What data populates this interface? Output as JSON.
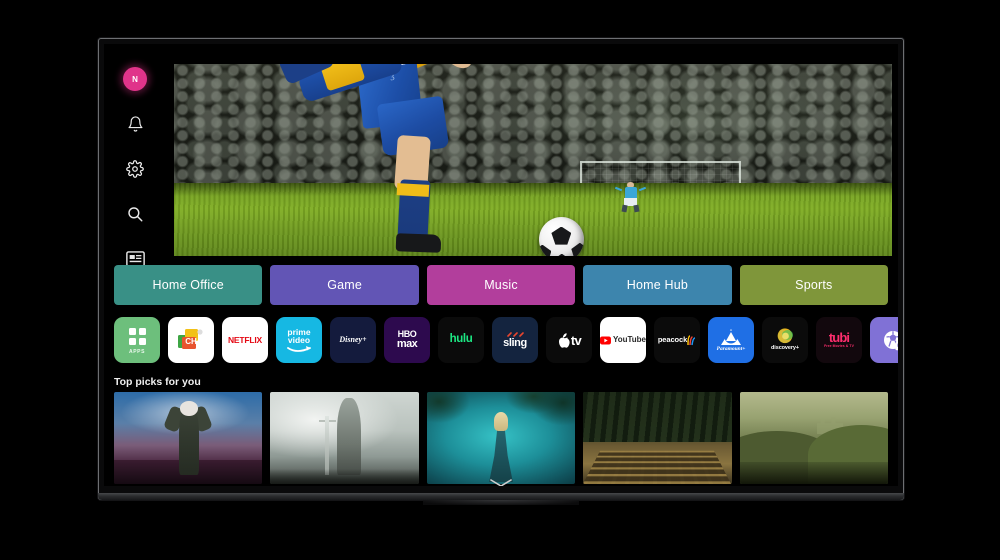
{
  "device": {
    "name": "smart-tv",
    "brand_ui": "webOS Home"
  },
  "sidebar": {
    "profile": {
      "initial": "N",
      "color": "#e0348a",
      "icon": "user-avatar"
    },
    "items": [
      {
        "id": "notifications",
        "icon": "bell-icon",
        "label": "Notifications"
      },
      {
        "id": "settings",
        "icon": "gear-icon",
        "label": "Settings"
      },
      {
        "id": "search",
        "icon": "search-icon",
        "label": "Search"
      },
      {
        "id": "inputs",
        "icon": "input-source-icon",
        "label": "Inputs"
      }
    ]
  },
  "hero": {
    "name": "sports-hero-banner",
    "description": "Soccer player kicking ball toward goal in the rain",
    "alt": "Sports"
  },
  "categories": [
    {
      "label": "Home Office",
      "color": "#399086"
    },
    {
      "label": "Game",
      "color": "#6255b5"
    },
    {
      "label": "Music",
      "color": "#b23e9c"
    },
    {
      "label": "Home Hub",
      "color": "#3d85ad"
    },
    {
      "label": "Sports",
      "color": "#7f963a"
    }
  ],
  "apps": [
    {
      "id": "apps",
      "label": "APPS",
      "sub": "",
      "bg": "#6dbf7c",
      "fg": "#ffffff",
      "icon": "grid-apps-icon"
    },
    {
      "id": "channels",
      "label": "CH",
      "sub": "",
      "bg": "#ffffff",
      "fg": "#e8542f",
      "icon": "channels-icon"
    },
    {
      "id": "netflix",
      "label": "NETFLIX",
      "sub": "",
      "bg": "#ffffff",
      "fg": "#e50914",
      "icon": "netflix-icon"
    },
    {
      "id": "prime-video",
      "label": "prime",
      "sub": "video",
      "bg": "#16b8e3",
      "fg": "#ffffff",
      "icon": "prime-video-icon"
    },
    {
      "id": "disney-plus",
      "label": "Disney+",
      "sub": "",
      "bg": "#141b3d",
      "fg": "#ffffff",
      "icon": "disney-plus-icon"
    },
    {
      "id": "hbo-max",
      "label": "HBO",
      "sub": "max",
      "bg": "#2d0a4e",
      "fg": "#ffffff",
      "icon": "hbo-max-icon"
    },
    {
      "id": "hulu",
      "label": "hulu",
      "sub": "",
      "bg": "#0b0b0b",
      "fg": "#1ce783",
      "icon": "hulu-icon"
    },
    {
      "id": "sling",
      "label": "sling",
      "sub": "",
      "bg": "#14243f",
      "fg": "#ffffff",
      "icon": "sling-icon"
    },
    {
      "id": "apple-tv",
      "label": "tv",
      "sub": "",
      "bg": "#0b0b0b",
      "fg": "#ffffff",
      "icon": "apple-tv-icon"
    },
    {
      "id": "youtube",
      "label": "YouTube",
      "sub": "",
      "bg": "#ffffff",
      "fg": "#282828",
      "icon": "youtube-icon"
    },
    {
      "id": "peacock",
      "label": "peacock",
      "sub": "",
      "bg": "#0b0b0b",
      "fg": "#ffffff",
      "icon": "peacock-icon"
    },
    {
      "id": "paramount",
      "label": "Paramount+",
      "sub": "",
      "bg": "#1f6fe5",
      "fg": "#ffffff",
      "icon": "paramount-plus-icon"
    },
    {
      "id": "discovery",
      "label": "discovery+",
      "sub": "",
      "bg": "#0b0b0b",
      "fg": "#ffffff",
      "icon": "discovery-plus-icon"
    },
    {
      "id": "tubi",
      "label": "tubi",
      "sub": "Free Movies & TV",
      "bg": "#12080d",
      "fg": "#ff2e6e",
      "icon": "tubi-icon"
    },
    {
      "id": "sports-app",
      "label": "",
      "sub": "",
      "bg": "#8071d6",
      "fg": "#ffffff",
      "icon": "soccer-ball-icon"
    }
  ],
  "top_picks": {
    "title": "Top picks for you",
    "items": [
      {
        "id": "pick-1",
        "art": "p1",
        "alt": "Person in hooded coat on mountain at dawn"
      },
      {
        "id": "pick-2",
        "art": "p2",
        "alt": "Stone statue holding sword in clouds"
      },
      {
        "id": "pick-3",
        "art": "p3",
        "alt": "Woman in gown in teal misty forest"
      },
      {
        "id": "pick-4",
        "art": "p4",
        "alt": "Hedge maze beside dark pine forest"
      },
      {
        "id": "pick-5",
        "art": "p5",
        "alt": "Olive green hills with distant castle"
      }
    ]
  },
  "footer": {
    "scroll_hint_icon": "chevron-down-icon"
  }
}
